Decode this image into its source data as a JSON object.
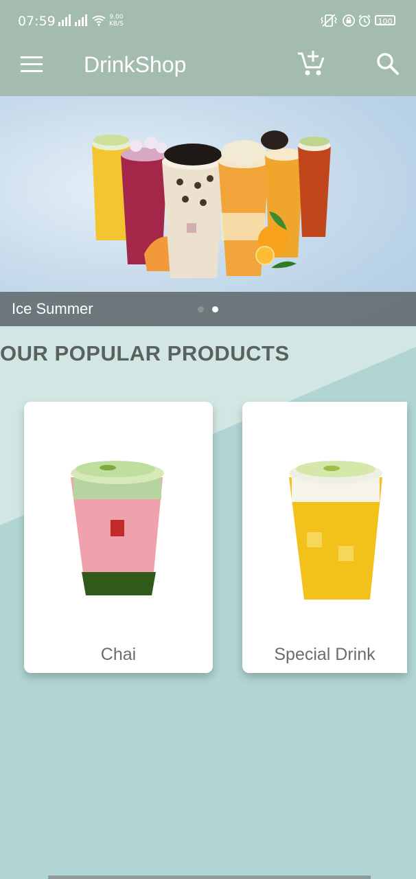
{
  "status_bar": {
    "time": "07:59",
    "net_speed_value": "9.00",
    "net_speed_unit": "KB/S",
    "battery": "100",
    "icons": [
      "signal-icon",
      "signal-icon",
      "wifi-icon",
      "vibrate-icon",
      "lock-rotation-icon",
      "alarm-icon",
      "battery-icon"
    ]
  },
  "app_bar": {
    "title": "DrinkShop",
    "icons": [
      "menu-icon",
      "cart-add-icon",
      "search-icon"
    ],
    "color": "#a4bbb0"
  },
  "banner": {
    "caption": "Ice Summer",
    "slide_count": 2,
    "active_slide": 2
  },
  "popular": {
    "title": "OUR POPULAR PRODUCTS",
    "products": [
      {
        "name": "Chai"
      },
      {
        "name": "Special Drink"
      }
    ]
  },
  "colors": {
    "background": "#b1d5d3",
    "accent": "#a4bbb0",
    "title_text": "#5a625f"
  }
}
